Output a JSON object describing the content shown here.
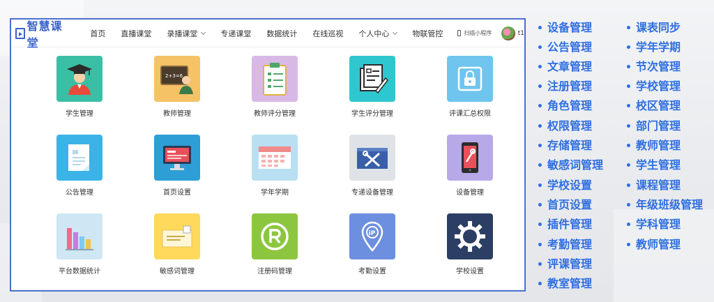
{
  "header": {
    "logo_text": "智慧课堂",
    "nav": [
      {
        "label": "首页",
        "has_dropdown": false
      },
      {
        "label": "直播课堂",
        "has_dropdown": false
      },
      {
        "label": "录播课堂",
        "has_dropdown": true
      },
      {
        "label": "专递课堂",
        "has_dropdown": false
      },
      {
        "label": "数据统计",
        "has_dropdown": false
      },
      {
        "label": "在线巡视",
        "has_dropdown": false
      },
      {
        "label": "个人中心",
        "has_dropdown": true
      },
      {
        "label": "物联管控",
        "has_dropdown": false
      }
    ],
    "scan_label": "扫描小程序",
    "username": "t1"
  },
  "tiles": [
    {
      "label": "学生管理",
      "icon": "student-graduate-icon",
      "color": "#3bbfa4"
    },
    {
      "label": "教师管理",
      "icon": "teacher-blackboard-icon",
      "color": "#f6c266"
    },
    {
      "label": "教师评分管理",
      "icon": "clipboard-checklist-icon",
      "color": "#d8b9e6"
    },
    {
      "label": "学生评分管理",
      "icon": "grading-pen-icon",
      "color": "#2fc7cf"
    },
    {
      "label": "评课汇总权限",
      "icon": "lock-shield-icon",
      "color": "#6fc5ee"
    },
    {
      "label": "公告管理",
      "icon": "notice-document-icon",
      "color": "#3bb3e8"
    },
    {
      "label": "首页设置",
      "icon": "monitor-screen-icon",
      "color": "#2e9ed6"
    },
    {
      "label": "学年学期",
      "icon": "calendar-grid-icon",
      "color": "#b9e0f2"
    },
    {
      "label": "专递设备管理",
      "icon": "toolbox-wrench-icon",
      "color": "#dfe3e8"
    },
    {
      "label": "设备管理",
      "icon": "tablet-device-icon",
      "color": "#b7a9e8"
    },
    {
      "label": "平台数据统计",
      "icon": "bar-chart-icon",
      "color": "#cfe6f4"
    },
    {
      "label": "敏感词管理",
      "icon": "envelope-note-icon",
      "color": "#ffd95c"
    },
    {
      "label": "注册码管理",
      "icon": "registered-mark-icon",
      "color": "#8cc63f"
    },
    {
      "label": "考勤设置",
      "icon": "location-pin-icon",
      "color": "#6d8fe0"
    },
    {
      "label": "学校设置",
      "icon": "gear-icon",
      "color": "#2c3e63"
    }
  ],
  "feature_list": {
    "column1": [
      "设备管理",
      "公告管理",
      "文章管理",
      "注册管理",
      "角色管理",
      "权限管理",
      "存储管理",
      "敏感词管理",
      "学校设置",
      "首页设置",
      "插件管理",
      "考勤管理",
      "评课管理",
      "教室管理"
    ],
    "column2": [
      "课表同步",
      "学年学期",
      "节次管理",
      "学校管理",
      "校区管理",
      "部门管理",
      "教师管理",
      "学生管理",
      "课程管理",
      "年级班级管理",
      "学科管理",
      "教师管理"
    ],
    "color": "#2f6fe0"
  }
}
